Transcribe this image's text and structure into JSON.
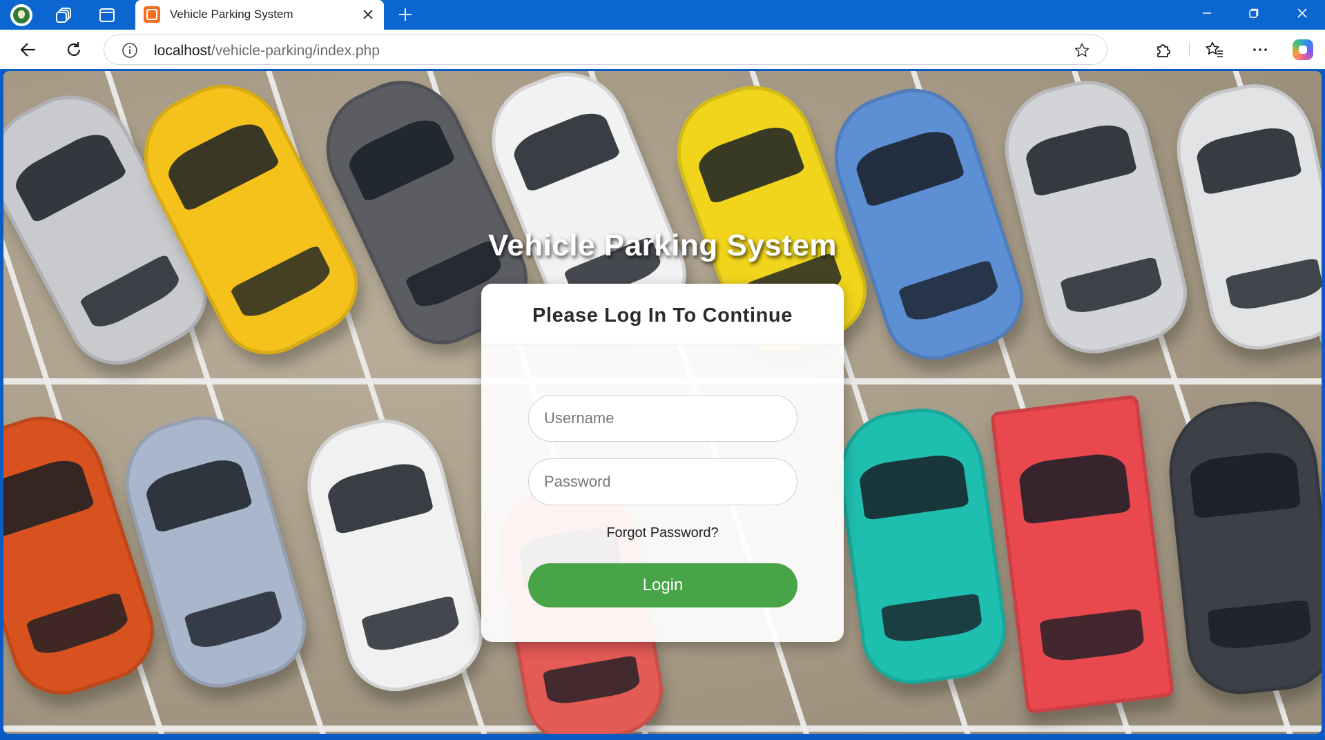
{
  "browser": {
    "tab": {
      "title": "Vehicle Parking System"
    },
    "address": {
      "host": "localhost",
      "path": "/vehicle-parking/index.php"
    }
  },
  "page": {
    "title": "Vehicle Parking System",
    "login": {
      "heading": "Please Log In To Continue",
      "username_placeholder": "Username",
      "password_placeholder": "Password",
      "forgot_label": "Forgot Password?",
      "login_label": "Login"
    }
  },
  "colors": {
    "browser_accent": "#0c66d1",
    "login_button": "#47a447"
  }
}
